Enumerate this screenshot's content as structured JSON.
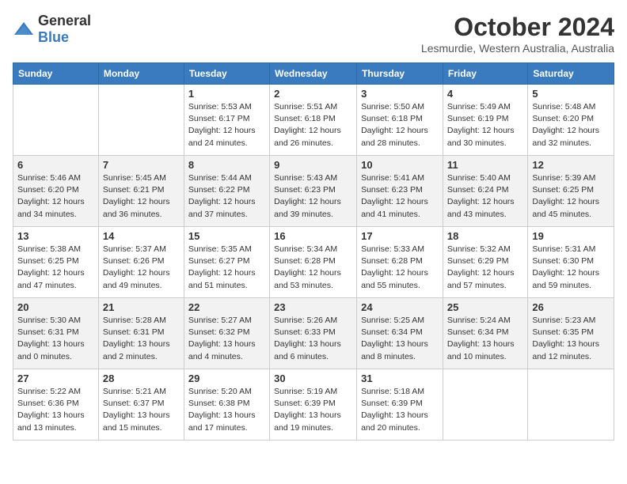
{
  "header": {
    "logo_general": "General",
    "logo_blue": "Blue",
    "month": "October 2024",
    "location": "Lesmurdie, Western Australia, Australia"
  },
  "days_of_week": [
    "Sunday",
    "Monday",
    "Tuesday",
    "Wednesday",
    "Thursday",
    "Friday",
    "Saturday"
  ],
  "weeks": [
    [
      {
        "day": "",
        "text": ""
      },
      {
        "day": "",
        "text": ""
      },
      {
        "day": "1",
        "text": "Sunrise: 5:53 AM\nSunset: 6:17 PM\nDaylight: 12 hours and 24 minutes."
      },
      {
        "day": "2",
        "text": "Sunrise: 5:51 AM\nSunset: 6:18 PM\nDaylight: 12 hours and 26 minutes."
      },
      {
        "day": "3",
        "text": "Sunrise: 5:50 AM\nSunset: 6:18 PM\nDaylight: 12 hours and 28 minutes."
      },
      {
        "day": "4",
        "text": "Sunrise: 5:49 AM\nSunset: 6:19 PM\nDaylight: 12 hours and 30 minutes."
      },
      {
        "day": "5",
        "text": "Sunrise: 5:48 AM\nSunset: 6:20 PM\nDaylight: 12 hours and 32 minutes."
      }
    ],
    [
      {
        "day": "6",
        "text": "Sunrise: 5:46 AM\nSunset: 6:20 PM\nDaylight: 12 hours and 34 minutes."
      },
      {
        "day": "7",
        "text": "Sunrise: 5:45 AM\nSunset: 6:21 PM\nDaylight: 12 hours and 36 minutes."
      },
      {
        "day": "8",
        "text": "Sunrise: 5:44 AM\nSunset: 6:22 PM\nDaylight: 12 hours and 37 minutes."
      },
      {
        "day": "9",
        "text": "Sunrise: 5:43 AM\nSunset: 6:23 PM\nDaylight: 12 hours and 39 minutes."
      },
      {
        "day": "10",
        "text": "Sunrise: 5:41 AM\nSunset: 6:23 PM\nDaylight: 12 hours and 41 minutes."
      },
      {
        "day": "11",
        "text": "Sunrise: 5:40 AM\nSunset: 6:24 PM\nDaylight: 12 hours and 43 minutes."
      },
      {
        "day": "12",
        "text": "Sunrise: 5:39 AM\nSunset: 6:25 PM\nDaylight: 12 hours and 45 minutes."
      }
    ],
    [
      {
        "day": "13",
        "text": "Sunrise: 5:38 AM\nSunset: 6:25 PM\nDaylight: 12 hours and 47 minutes."
      },
      {
        "day": "14",
        "text": "Sunrise: 5:37 AM\nSunset: 6:26 PM\nDaylight: 12 hours and 49 minutes."
      },
      {
        "day": "15",
        "text": "Sunrise: 5:35 AM\nSunset: 6:27 PM\nDaylight: 12 hours and 51 minutes."
      },
      {
        "day": "16",
        "text": "Sunrise: 5:34 AM\nSunset: 6:28 PM\nDaylight: 12 hours and 53 minutes."
      },
      {
        "day": "17",
        "text": "Sunrise: 5:33 AM\nSunset: 6:28 PM\nDaylight: 12 hours and 55 minutes."
      },
      {
        "day": "18",
        "text": "Sunrise: 5:32 AM\nSunset: 6:29 PM\nDaylight: 12 hours and 57 minutes."
      },
      {
        "day": "19",
        "text": "Sunrise: 5:31 AM\nSunset: 6:30 PM\nDaylight: 12 hours and 59 minutes."
      }
    ],
    [
      {
        "day": "20",
        "text": "Sunrise: 5:30 AM\nSunset: 6:31 PM\nDaylight: 13 hours and 0 minutes."
      },
      {
        "day": "21",
        "text": "Sunrise: 5:28 AM\nSunset: 6:31 PM\nDaylight: 13 hours and 2 minutes."
      },
      {
        "day": "22",
        "text": "Sunrise: 5:27 AM\nSunset: 6:32 PM\nDaylight: 13 hours and 4 minutes."
      },
      {
        "day": "23",
        "text": "Sunrise: 5:26 AM\nSunset: 6:33 PM\nDaylight: 13 hours and 6 minutes."
      },
      {
        "day": "24",
        "text": "Sunrise: 5:25 AM\nSunset: 6:34 PM\nDaylight: 13 hours and 8 minutes."
      },
      {
        "day": "25",
        "text": "Sunrise: 5:24 AM\nSunset: 6:34 PM\nDaylight: 13 hours and 10 minutes."
      },
      {
        "day": "26",
        "text": "Sunrise: 5:23 AM\nSunset: 6:35 PM\nDaylight: 13 hours and 12 minutes."
      }
    ],
    [
      {
        "day": "27",
        "text": "Sunrise: 5:22 AM\nSunset: 6:36 PM\nDaylight: 13 hours and 13 minutes."
      },
      {
        "day": "28",
        "text": "Sunrise: 5:21 AM\nSunset: 6:37 PM\nDaylight: 13 hours and 15 minutes."
      },
      {
        "day": "29",
        "text": "Sunrise: 5:20 AM\nSunset: 6:38 PM\nDaylight: 13 hours and 17 minutes."
      },
      {
        "day": "30",
        "text": "Sunrise: 5:19 AM\nSunset: 6:39 PM\nDaylight: 13 hours and 19 minutes."
      },
      {
        "day": "31",
        "text": "Sunrise: 5:18 AM\nSunset: 6:39 PM\nDaylight: 13 hours and 20 minutes."
      },
      {
        "day": "",
        "text": ""
      },
      {
        "day": "",
        "text": ""
      }
    ]
  ]
}
